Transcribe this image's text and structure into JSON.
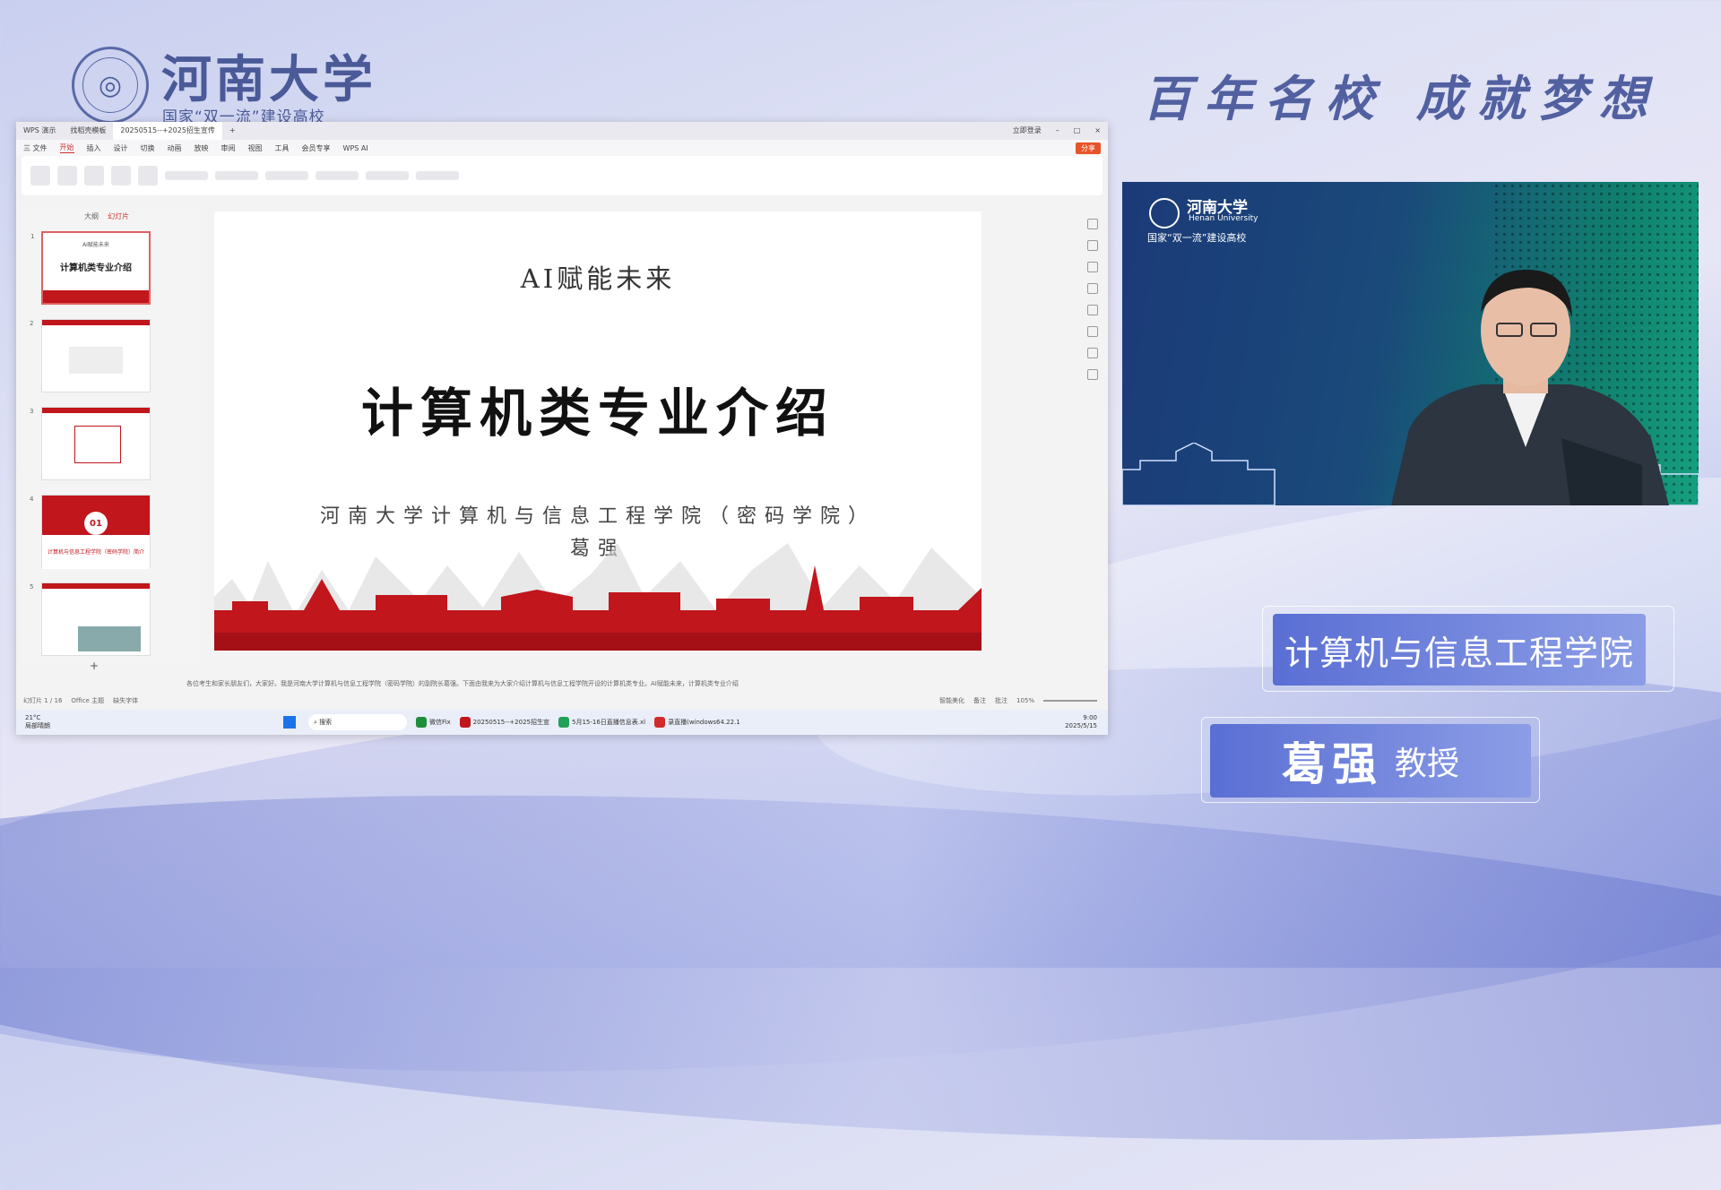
{
  "background": {
    "university_title": "河南大学",
    "university_subtitle": "国家“双一流”建设高校",
    "slogan": "百年名校  成就梦想"
  },
  "wps": {
    "tabs": [
      "WPS 演示",
      "找稻壳模板",
      "20250515--+2025招生宣传",
      "+"
    ],
    "login": "立即登录",
    "share": "分享",
    "menus": [
      "三 文件",
      "开始",
      "插入",
      "设计",
      "切换",
      "动画",
      "放映",
      "审阅",
      "视图",
      "工具",
      "会员专享",
      "WPS AI"
    ],
    "active_menu": "开始",
    "panel_tabs": [
      "大纲",
      "幻灯片"
    ],
    "thumbnails": [
      {
        "num": "1",
        "title": "计算机类专业介绍",
        "kicker": "AI赋能未来"
      },
      {
        "num": "2"
      },
      {
        "num": "3"
      },
      {
        "num": "4",
        "badge": "01",
        "caption": "计算机与信息工程学院（密码学院）简介"
      },
      {
        "num": "5"
      }
    ],
    "add_slide": "+",
    "notes": "各位考生和家长朋友们，大家好。我是河南大学计算机与信息工程学院（密码学院）的副院长葛强。下面由我来为大家介绍计算机与信息工程学院开设的计算机类专业。AI赋能未来，计算机类专业介绍",
    "status_left": [
      "幻灯片 1 / 16",
      "Office 主题",
      "缺失字体"
    ],
    "status_right": [
      "智能美化",
      "备注",
      "批注",
      "105%"
    ]
  },
  "slide": {
    "subtitle": "AI赋能未来",
    "title": "计算机类专业介绍",
    "school": "河南大学计算机与信息工程学院（密码学院）",
    "presenter": "葛强"
  },
  "taskbar": {
    "weather_temp": "21°C",
    "weather_desc": "局部晴朗",
    "search": "搜索",
    "apps": [
      "微信Fix",
      "20250515--+2025招生宣",
      "5月15-16日直播信息表.xl",
      "录直播(windows64.22.1"
    ],
    "time": "9:00",
    "date": "2025/5/15",
    "colors": [
      "#1f8f3a",
      "#c0161c",
      "#22a05a",
      "#d02a2a"
    ]
  },
  "camera": {
    "logo_cn": "河南大学",
    "logo_en": "Henan University",
    "logo_sub": "国家“双一流”建设高校"
  },
  "labels": {
    "college": "计算机与信息工程学院",
    "name": "葛强",
    "title": "教授"
  }
}
